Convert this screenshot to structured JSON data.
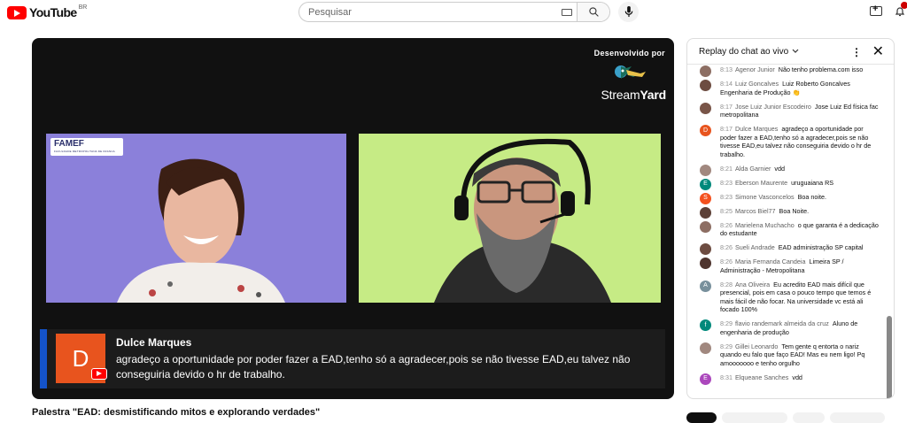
{
  "header": {
    "logo_text": "YouTube",
    "country": "BR",
    "search_placeholder": "Pesquisar"
  },
  "video": {
    "developed_by": "Desenvolvido por",
    "brand": "StreamYard",
    "brand_a": "Stream",
    "brand_b": "Yard",
    "famef_logo": "FAMEF",
    "famef_sub": "FACULDADE METROPOLITANA DE FRANCA",
    "caption_name": "Dulce Marques",
    "caption_initial": "D",
    "caption_text": "agradeço a oportunidade por poder fazer a EAD,tenho só a agradecer,pois se não tivesse EAD,eu talvez não conseguiria devido o hr de trabalho.",
    "title": "Palestra \"EAD: desmistificando mitos e explorando verdades\""
  },
  "chat": {
    "header": "Replay do chat ao vivo",
    "messages": [
      {
        "time": "8:13",
        "name": "Agenor Junior",
        "text": "Não tenho problema.com isso",
        "color": "#8d6e63",
        "initial": ""
      },
      {
        "time": "8:14",
        "name": "Luiz Goncalves",
        "text": "Luiz Roberto Goncalves Engenharia de Produção 👏",
        "color": "#6d4c41",
        "initial": ""
      },
      {
        "time": "8:17",
        "name": "Jose Luiz Junior Escodeiro",
        "text": "Jose Luiz Ed física fac metropolitana",
        "color": "#795548",
        "initial": ""
      },
      {
        "time": "8:17",
        "name": "Dulce Marques",
        "text": "agradeço a oportunidade por poder fazer a EAD,tenho só a agradecer,pois se não tivesse EAD,eu talvez não conseguiria devido o hr de trabalho.",
        "color": "#e8541e",
        "initial": "D"
      },
      {
        "time": "8:21",
        "name": "Alda Garnier",
        "text": "vdd",
        "color": "#a1887f",
        "initial": ""
      },
      {
        "time": "8:23",
        "name": "Eberson Maurente",
        "text": "uruguaiana RS",
        "color": "#00897b",
        "initial": "E"
      },
      {
        "time": "8:23",
        "name": "Simone Vasconcelos",
        "text": "Boa noite.",
        "color": "#f4511e",
        "initial": "S"
      },
      {
        "time": "8:25",
        "name": "Marcos Biel77",
        "text": "Boa Noite.",
        "color": "#5d4037",
        "initial": ""
      },
      {
        "time": "8:26",
        "name": "Marielena Muchacho",
        "text": "o que garanta é a dedicação do estudante",
        "color": "#8d6e63",
        "initial": ""
      },
      {
        "time": "8:26",
        "name": "Sueli Andrade",
        "text": "EAD administração SP capital",
        "color": "#6d4c41",
        "initial": ""
      },
      {
        "time": "8:26",
        "name": "Maria Fernanda Candeia",
        "text": "Limeira SP / Administração - Metropolitana",
        "color": "#4e342e",
        "initial": ""
      },
      {
        "time": "8:28",
        "name": "Ana Oliveira",
        "text": "Eu acredito EAD mais difícil que presencial, pois em casa o pouco tempo que temos é mais fácil de não focar. Na universidade vc está ali focado 100%",
        "color": "#78909c",
        "initial": "A"
      },
      {
        "time": "8:29",
        "name": "flavio randemark almeida da cruz",
        "text": "Aluno de engenharia de produção",
        "color": "#00897b",
        "initial": "f"
      },
      {
        "time": "8:29",
        "name": "Gillei Leonardo",
        "text": "Tem gente q entorta o nariz quando eu falo que faço EAD! Mas eu nem ligo! Pq amooooooo e tenho orgulho",
        "color": "#a1887f",
        "initial": ""
      },
      {
        "time": "8:31",
        "name": "Elqueane Sanches",
        "text": "vdd",
        "color": "#ab47bc",
        "initial": "E"
      }
    ]
  }
}
